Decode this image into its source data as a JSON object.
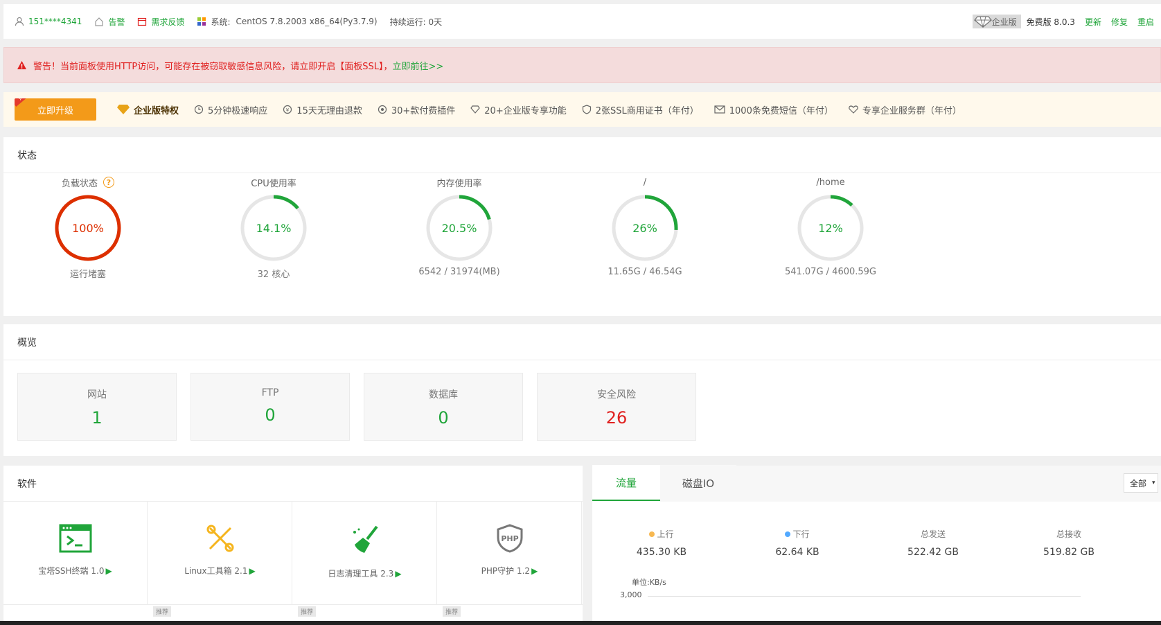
{
  "topbar": {
    "user": "151****4341",
    "alarm": "告警",
    "feedback": "需求反馈",
    "system_label": "系统:",
    "system_value": "CentOS 7.8.2003 x86_64(Py3.7.9)",
    "uptime": "持续运行: 0天",
    "enterprise_badge": "企业版",
    "version": "免费版 8.0.3",
    "update": "更新",
    "repair": "修复",
    "restart": "重启"
  },
  "warning": {
    "text": "警告！当前面板使用HTTP访问，可能存在被窃取敏感信息风险，请立即开启【面板SSL】，",
    "link": "立即前往>>"
  },
  "promo": {
    "tag": "推荐",
    "upgrade": "立即升级",
    "features": [
      "企业版特权",
      "5分钟极速响应",
      "15天无理由退款",
      "30+款付费插件",
      "20+企业版专享功能",
      "2张SSL商用证书（年付）",
      "1000条免费短信（年付）",
      "专享企业服务群（年付）"
    ]
  },
  "status": {
    "title": "状态",
    "gauges": [
      {
        "label": "负载状态",
        "value": "100%",
        "pct": 100,
        "sub": "运行堵塞",
        "color": "#dd2f00"
      },
      {
        "label": "CPU使用率",
        "value": "14.1%",
        "pct": 14.1,
        "sub": "32 核心",
        "color": "#20a53a"
      },
      {
        "label": "内存使用率",
        "value": "20.5%",
        "pct": 20.5,
        "sub": "6542 / 31974(MB)",
        "color": "#20a53a"
      },
      {
        "label": "/",
        "value": "26%",
        "pct": 26,
        "sub": "11.65G / 46.54G",
        "color": "#20a53a"
      },
      {
        "label": "/home",
        "value": "12%",
        "pct": 12,
        "sub": "541.07G / 4600.59G",
        "color": "#20a53a"
      }
    ]
  },
  "overview": {
    "title": "概览",
    "cards": [
      {
        "label": "网站",
        "value": "1"
      },
      {
        "label": "FTP",
        "value": "0"
      },
      {
        "label": "数据库",
        "value": "0"
      },
      {
        "label": "安全风险",
        "value": "26"
      }
    ]
  },
  "software": {
    "title": "软件",
    "items": [
      {
        "label": "宝塔SSH终端 1.0",
        "icon": "terminal-icon"
      },
      {
        "label": "Linux工具箱 2.1",
        "icon": "tools-icon"
      },
      {
        "label": "日志清理工具 2.3",
        "icon": "broom-icon"
      },
      {
        "label": "PHP守护 1.2",
        "icon": "php-shield-icon"
      }
    ],
    "rec_tag": "推荐"
  },
  "traffic": {
    "tabs": [
      "流量",
      "磁盘IO"
    ],
    "select": "全部",
    "stats": [
      {
        "label": "上行",
        "value": "435.30 KB",
        "dot": "#f7b851"
      },
      {
        "label": "下行",
        "value": "62.64 KB",
        "dot": "#52a9ff"
      },
      {
        "label": "总发送",
        "value": "522.42 GB"
      },
      {
        "label": "总接收",
        "value": "519.82 GB"
      }
    ],
    "unit": "单位:KB/s",
    "tick": "3,000"
  }
}
